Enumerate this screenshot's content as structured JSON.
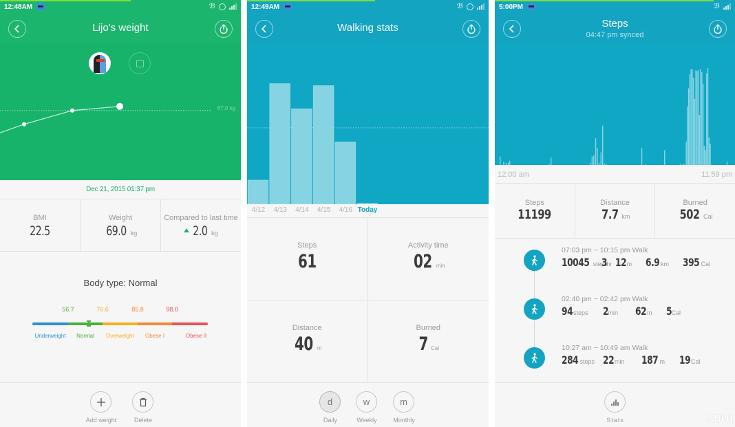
{
  "panels": {
    "weight": {
      "status": {
        "time": "12:48AM"
      },
      "header": {
        "title": "Lijo's weight"
      },
      "accent": "#17b36b",
      "chart": {
        "type": "line",
        "reference_label": "67.0 kg",
        "reference_value": 67.0,
        "points_kg": [
          64.6,
          65.3,
          67.0,
          67.2,
          69.0
        ],
        "visible_point_count": 4,
        "ylim": [
          58,
          72
        ]
      },
      "date": "Dec 21, 2015 01:37 pm",
      "stats": [
        {
          "label": "BMI",
          "value": "22.5",
          "unit": ""
        },
        {
          "label": "Weight",
          "value": "69.0",
          "unit": "kg"
        },
        {
          "label": "Compared to last time",
          "value": "2.0",
          "unit": "kg",
          "trend": "up"
        }
      ],
      "body_type": "Body type: Normal",
      "bmi_scale": {
        "thresholds": [
          {
            "value": "56.7",
            "color": "#5bb34a"
          },
          {
            "value": "76.6",
            "color": "#f3b022"
          },
          {
            "value": "85.8",
            "color": "#f08a3a"
          },
          {
            "value": "98.0",
            "color": "#e9545a"
          }
        ],
        "segments": [
          {
            "label": "Underweight",
            "color": "#2f8fd6"
          },
          {
            "label": "Normal",
            "color": "#4caf3a"
          },
          {
            "label": "Overweight",
            "color": "#f3b022"
          },
          {
            "label": "Obese I",
            "color": "#f08a3a"
          },
          {
            "label": "Obese II",
            "color": "#e9545a"
          }
        ],
        "marker_position_fraction": 0.32
      },
      "actions": [
        {
          "label": "Add weight",
          "icon": "plus-icon"
        },
        {
          "label": "Delete",
          "icon": "trash-icon"
        }
      ]
    },
    "walking": {
      "status": {
        "time": "12:49AM"
      },
      "header": {
        "title": "Walking stats"
      },
      "accent": "#10a7c4",
      "chart": {
        "type": "bar",
        "categories": [
          "4/12",
          "4/13",
          "4/14",
          "4/15",
          "4/16",
          "Today"
        ],
        "values": [
          1200,
          6000,
          4750,
          5900,
          3100,
          61
        ],
        "goal_line": 3800,
        "ylim": [
          0,
          8000
        ],
        "selected": "Today"
      },
      "stats": [
        {
          "label": "Steps",
          "value": "61",
          "unit": ""
        },
        {
          "label": "Activity time",
          "value": "02",
          "unit": "min"
        },
        {
          "label": "Distance",
          "value": "40",
          "unit": "m"
        },
        {
          "label": "Burned",
          "value": "7",
          "unit": "Cal"
        }
      ],
      "periods": [
        {
          "letter": "d",
          "label": "Daily",
          "active": true
        },
        {
          "letter": "w",
          "label": "Weekly",
          "active": false
        },
        {
          "letter": "m",
          "label": "Monthly",
          "active": false
        }
      ]
    },
    "steps": {
      "status": {
        "time": "5:00PM"
      },
      "header": {
        "title": "Steps",
        "subtitle": "04:47 pm synced"
      },
      "accent": "#10a7c4",
      "chart": {
        "type": "bar",
        "x_start_label": "12:00 am",
        "x_end_label": "11:59 pm",
        "values": [
          0,
          0,
          0,
          0,
          0,
          0,
          4,
          0,
          2,
          1,
          1,
          1,
          3,
          0,
          0,
          0,
          0,
          0,
          0,
          0,
          0,
          0,
          0,
          0,
          0,
          0,
          0,
          0,
          0,
          0,
          0,
          0,
          0,
          0,
          0,
          0,
          0,
          0,
          0,
          0,
          0,
          0,
          0,
          0,
          0,
          0,
          0,
          0,
          0,
          0,
          0,
          0,
          0,
          0,
          0,
          0,
          0,
          0,
          0,
          0,
          0,
          0,
          0,
          0,
          0,
          0,
          0,
          0,
          0,
          0,
          0,
          0,
          0,
          0,
          0,
          0,
          0,
          0,
          0,
          0,
          0,
          0,
          0,
          0,
          0,
          0,
          0,
          0,
          0,
          0,
          1,
          5,
          0,
          0,
          0,
          0,
          0,
          0,
          0,
          0,
          0,
          0,
          0,
          0,
          0,
          0,
          0,
          0,
          0,
          0,
          0,
          0,
          0,
          0,
          0,
          0,
          0,
          0,
          0,
          0,
          0,
          0,
          0,
          0,
          0,
          0,
          0,
          0,
          0,
          0,
          0,
          0,
          0,
          0,
          0,
          0,
          0,
          0,
          0,
          0,
          0,
          0,
          0,
          0,
          0,
          0,
          0,
          0,
          0,
          0,
          0,
          0,
          0,
          0,
          0,
          0,
          0,
          0,
          0,
          0,
          0,
          0,
          0,
          0,
          0,
          0,
          0,
          0,
          0,
          0,
          0,
          0,
          0,
          0,
          0,
          0,
          0,
          0,
          0,
          0,
          0,
          0,
          0,
          0,
          0,
          0,
          0,
          0,
          0,
          0,
          0,
          0,
          0,
          0,
          0,
          0,
          0,
          0,
          0,
          0,
          0,
          0,
          0,
          0,
          0,
          0,
          0,
          0,
          0,
          0,
          0,
          0,
          0,
          0,
          0,
          0,
          0,
          0,
          0,
          0,
          0,
          0,
          0,
          0,
          0,
          0,
          0,
          0,
          0,
          0,
          0,
          0,
          0,
          0,
          0,
          0,
          0,
          0,
          0,
          0,
          0,
          0,
          0,
          0,
          0,
          0,
          0,
          0,
          0,
          0,
          0,
          0,
          0,
          0,
          0,
          0,
          0,
          0,
          0,
          0,
          0,
          0,
          0,
          0,
          0,
          0,
          0,
          0,
          0,
          0,
          0,
          0,
          0,
          0,
          0,
          0,
          0,
          0,
          0,
          0,
          0,
          0,
          0,
          0,
          0,
          0,
          0,
          0,
          0,
          0,
          0,
          0,
          0,
          0,
          0,
          0,
          0,
          0,
          0,
          0,
          0,
          0,
          0,
          0,
          0,
          0,
          0,
          0,
          0,
          0,
          0,
          0,
          0,
          0,
          0,
          0,
          0,
          0,
          0,
          0,
          0,
          0,
          0,
          0,
          0,
          0,
          0,
          0,
          0,
          0,
          0,
          0,
          0,
          0,
          0,
          0,
          0,
          0,
          0,
          0,
          0,
          0,
          0,
          0,
          0,
          0,
          0,
          0,
          0,
          0,
          0,
          0,
          0,
          0,
          0,
          0,
          0,
          0
        ],
        "spikes": [
          {
            "t": 0.02,
            "v": 8
          },
          {
            "t": 0.035,
            "v": 3
          },
          {
            "t": 0.045,
            "v": 2
          },
          {
            "t": 0.055,
            "v": 2
          },
          {
            "t": 0.06,
            "v": 4
          },
          {
            "t": 0.225,
            "v": 1
          },
          {
            "t": 0.232,
            "v": 7
          },
          {
            "t": 0.395,
            "v": 2
          },
          {
            "t": 0.403,
            "v": 8
          },
          {
            "t": 0.41,
            "v": 9
          },
          {
            "t": 0.418,
            "v": 25
          },
          {
            "t": 0.425,
            "v": 16
          },
          {
            "t": 0.432,
            "v": 2
          },
          {
            "t": 0.44,
            "v": 12
          },
          {
            "t": 0.447,
            "v": 37
          },
          {
            "t": 0.455,
            "v": 1
          },
          {
            "t": 0.462,
            "v": 1
          },
          {
            "t": 0.61,
            "v": 16
          },
          {
            "t": 0.625,
            "v": 1
          },
          {
            "t": 0.705,
            "v": 14
          },
          {
            "t": 0.77,
            "v": 1
          },
          {
            "t": 0.785,
            "v": 1
          },
          {
            "t": 0.795,
            "v": 22
          },
          {
            "t": 0.8,
            "v": 55
          },
          {
            "t": 0.805,
            "v": 72
          },
          {
            "t": 0.81,
            "v": 85
          },
          {
            "t": 0.815,
            "v": 90
          },
          {
            "t": 0.82,
            "v": 90
          },
          {
            "t": 0.825,
            "v": 82
          },
          {
            "t": 0.83,
            "v": 62
          },
          {
            "t": 0.835,
            "v": 89
          },
          {
            "t": 0.84,
            "v": 88
          },
          {
            "t": 0.845,
            "v": 89
          },
          {
            "t": 0.85,
            "v": 47
          },
          {
            "t": 0.855,
            "v": 90
          },
          {
            "t": 0.86,
            "v": 87
          },
          {
            "t": 0.865,
            "v": 76
          },
          {
            "t": 0.87,
            "v": 18
          },
          {
            "t": 0.875,
            "v": 14
          },
          {
            "t": 0.88,
            "v": 86
          },
          {
            "t": 0.885,
            "v": 91
          },
          {
            "t": 0.89,
            "v": 26
          },
          {
            "t": 0.895,
            "v": 20
          },
          {
            "t": 0.965,
            "v": 3
          }
        ],
        "ylim": [
          0,
          100
        ]
      },
      "stats": [
        {
          "label": "Steps",
          "value": "11199",
          "unit": ""
        },
        {
          "label": "Distance",
          "value": "7.7",
          "unit": "km"
        },
        {
          "label": "Burned",
          "value": "502",
          "unit": "Cal"
        }
      ],
      "walks": [
        {
          "title": "07:03 pm ~ 10:15 pm Walk",
          "steps": "10045",
          "steps_unit": "steps",
          "dur1": "3",
          "dur1_unit": "hr",
          "dur2": "12",
          "dur2_unit": "m",
          "dist": "6.9",
          "dist_unit": "km",
          "cal": "395",
          "cal_unit": "Cal"
        },
        {
          "title": "02:40 pm ~ 02:42 pm Walk",
          "steps": "94",
          "steps_unit": "steps",
          "dur1": "2",
          "dur1_unit": "min",
          "dist": "62",
          "dist_unit": "m",
          "cal": "5",
          "cal_unit": "Cal"
        },
        {
          "title": "10:27 am ~ 10:49 am Walk",
          "steps": "284",
          "steps_unit": "steps",
          "dur1": "22",
          "dur1_unit": "min",
          "dist": "187",
          "dist_unit": "m",
          "cal": "19",
          "cal_unit": "Cal"
        }
      ],
      "action": {
        "label": "Stats",
        "icon": "bar-chart-icon"
      },
      "watermark": "MIUI"
    }
  }
}
